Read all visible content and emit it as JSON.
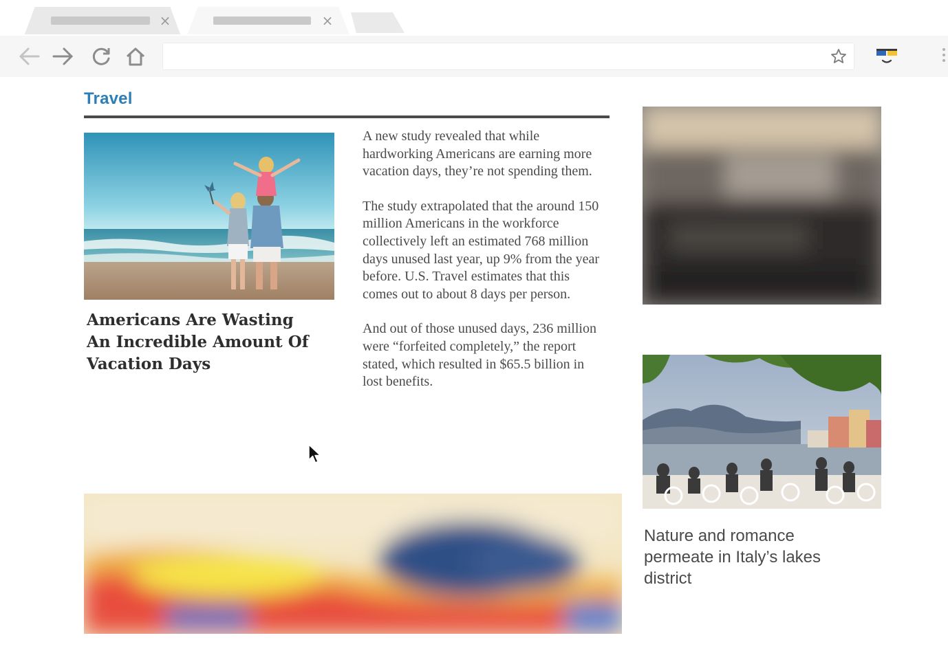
{
  "browser": {
    "tabs": [
      {
        "active": false
      },
      {
        "active": true
      }
    ],
    "close_glyph": "×",
    "icons": {
      "back": "back-arrow-icon",
      "forward": "forward-arrow-icon",
      "reload": "reload-icon",
      "home": "home-icon",
      "bookmark": "star-icon",
      "extension": "extension-icon",
      "menu": "menu-dots-icon"
    },
    "address_value": ""
  },
  "section": {
    "title": "Travel",
    "accent_color": "#2b7fb8"
  },
  "feature": {
    "headline": "Americans Are Wasting An Incredible Amount Of Vacation Days",
    "paragraphs": [
      "A new study revealed that while hardworking Americans are earning more vacation days, they’re not spending them.",
      "The study extrapolated that the around 150 million Americans in the workforce collectively left an estimated 768 million days unused last year, up 9% from the year before. U.S. Travel estimates that this comes out to about 8 days per person.",
      "And out of those unused days, 236 million were “forfeited completely,” the report stated, which resulted in $65.5 billion in lost benefits."
    ]
  },
  "sidebar": {
    "story_caption": "Nature and romance permeate in Italy’s lakes district"
  }
}
